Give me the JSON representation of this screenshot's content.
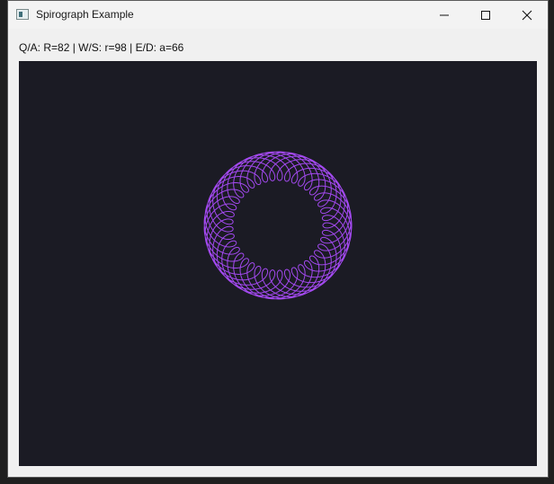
{
  "window": {
    "title": "Spirograph Example",
    "icon": "app-window-icon",
    "controls": [
      "minimize-icon",
      "maximize-icon",
      "close-icon"
    ]
  },
  "controls_text": "Q/A: R=82 | W/S: r=98 | E/D: a=66",
  "parameters": {
    "R": 82,
    "r": 98,
    "a": 66
  },
  "colors": {
    "canvas_background": "#1b1b24",
    "curve": "#a349f0"
  }
}
